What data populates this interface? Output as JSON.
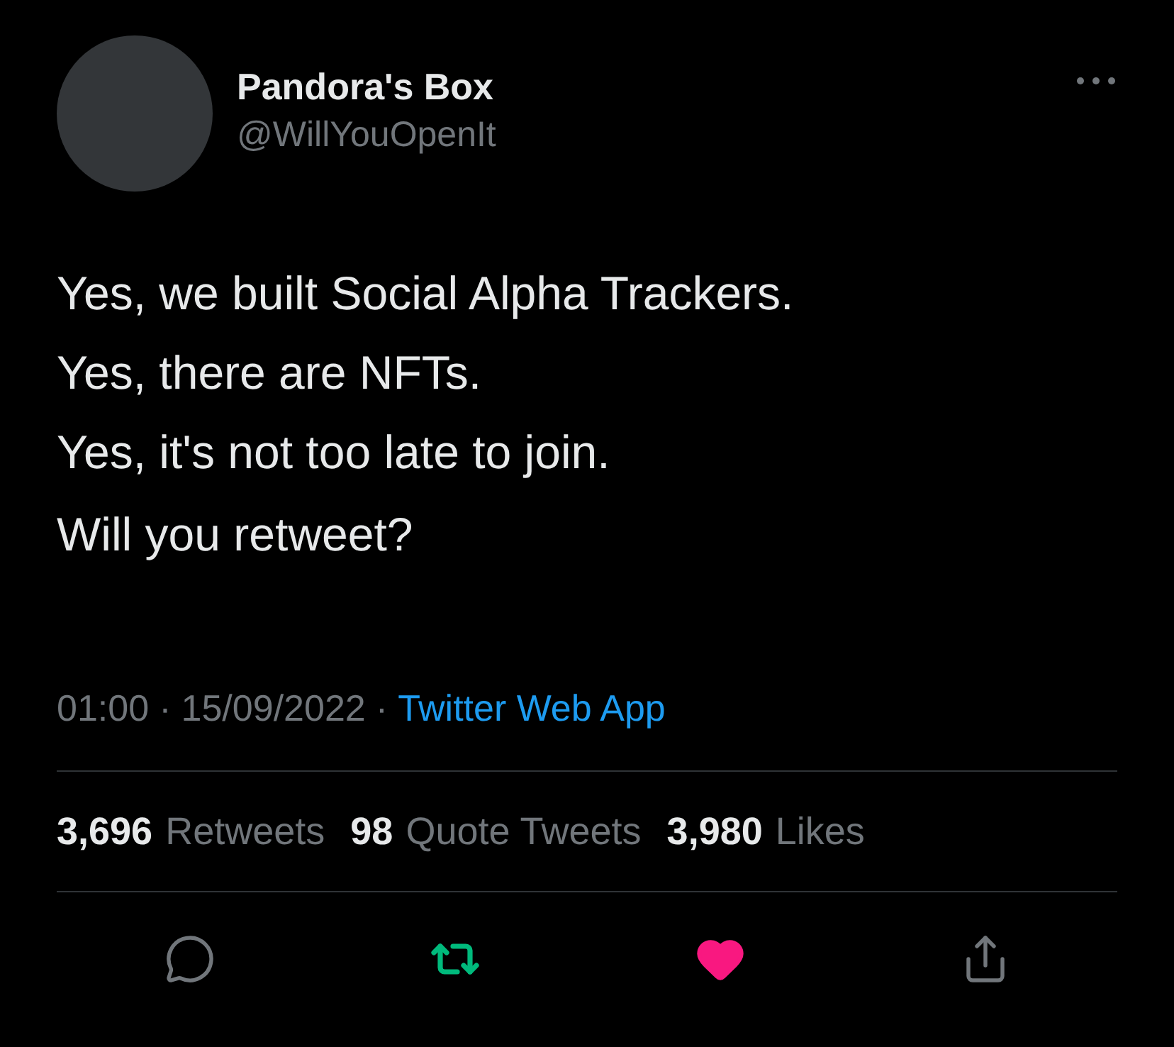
{
  "author": {
    "name": "Pandora's Box",
    "handle": "@WillYouOpenIt"
  },
  "paragraphs": [
    "Yes, we built Social Alpha Trackers.\nYes, there are NFTs.\nYes, it's not too late to join.",
    "Will you retweet?"
  ],
  "meta": [
    {
      "kind": "plain",
      "text": "01:00"
    },
    {
      "kind": "plain",
      "text": "·"
    },
    {
      "kind": "plain",
      "text": "15/09/2022"
    },
    {
      "kind": "plain",
      "text": "·"
    },
    {
      "kind": "link",
      "text": "Twitter Web App"
    }
  ],
  "stats": [
    {
      "count": "3,696",
      "label": "Retweets"
    },
    {
      "count": "98",
      "label": "Quote Tweets"
    },
    {
      "count": "3,980",
      "label": "Likes"
    }
  ],
  "actions": [
    {
      "kind": "reply",
      "active": false
    },
    {
      "kind": "retweet",
      "active": true
    },
    {
      "kind": "like",
      "active": true
    },
    {
      "kind": "share",
      "active": false
    }
  ]
}
